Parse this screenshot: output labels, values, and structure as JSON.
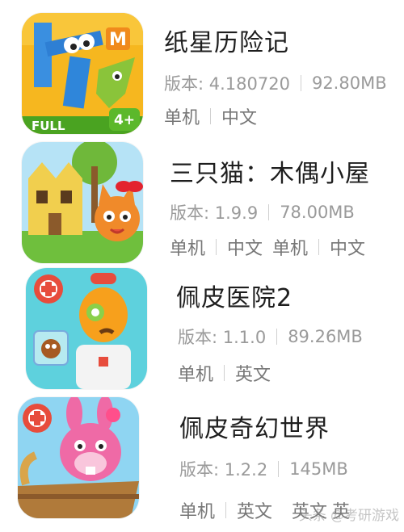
{
  "apps": [
    {
      "title": "纸星历险记",
      "version": "版本: 4.180720",
      "size": "92.80MB",
      "tags": [
        "单机",
        "中文"
      ],
      "icon": "paper-monster-icon",
      "icon_badges": {
        "full": "FULL",
        "age": "4+",
        "letter": "M"
      }
    },
    {
      "title": "三只猫：木偶小屋",
      "version": "版本: 1.9.9",
      "size": "78.00MB",
      "tags": [
        "单机",
        "中文",
        "单机",
        "中文"
      ],
      "icon": "cat-house-icon"
    },
    {
      "title": "佩皮医院2",
      "version": "版本: 1.1.0",
      "size": "89.26MB",
      "tags": [
        "单机",
        "英文"
      ],
      "icon": "hospital-doctor-icon"
    },
    {
      "title": "佩皮奇幻世界",
      "version": "版本: 1.2.2",
      "size": "145MB",
      "tags": [
        "单机",
        "英文",
        "英文",
        "英"
      ],
      "icon": "pink-bunny-boat-icon"
    }
  ],
  "watermark": "头条 @考研游戏"
}
